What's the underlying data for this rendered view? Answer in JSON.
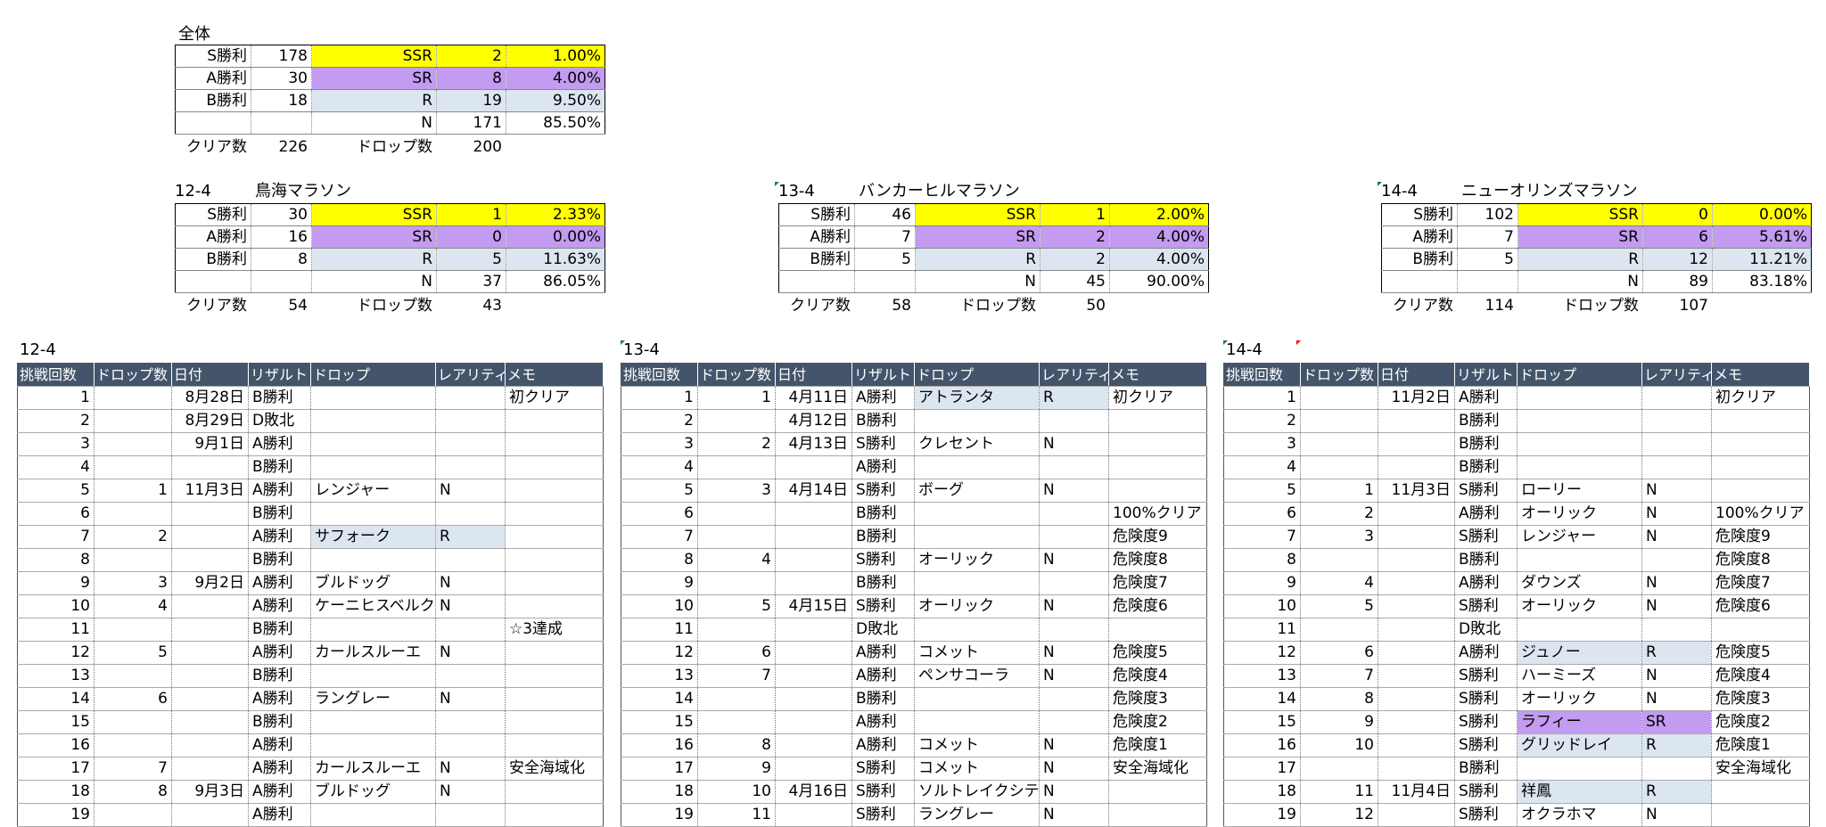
{
  "overall": {
    "label": "全体",
    "rows": [
      {
        "win": "S勝利",
        "wc": "178",
        "rar": "SSR",
        "cnt": "2",
        "pct": "1.00%"
      },
      {
        "win": "A勝利",
        "wc": "30",
        "rar": "SR",
        "cnt": "8",
        "pct": "4.00%"
      },
      {
        "win": "B勝利",
        "wc": "18",
        "rar": "R",
        "cnt": "19",
        "pct": "9.50%"
      },
      {
        "win": "",
        "wc": "",
        "rar": "N",
        "cnt": "171",
        "pct": "85.50%"
      }
    ],
    "clear_label": "クリア数",
    "clear": "226",
    "drop_label": "ドロップ数",
    "drop": "200"
  },
  "summaries": [
    {
      "id": "12-4",
      "name": "鳥海マラソン",
      "rows": [
        {
          "win": "S勝利",
          "wc": "30",
          "rar": "SSR",
          "cnt": "1",
          "pct": "2.33%"
        },
        {
          "win": "A勝利",
          "wc": "16",
          "rar": "SR",
          "cnt": "0",
          "pct": "0.00%"
        },
        {
          "win": "B勝利",
          "wc": "8",
          "rar": "R",
          "cnt": "5",
          "pct": "11.63%"
        },
        {
          "win": "",
          "wc": "",
          "rar": "N",
          "cnt": "37",
          "pct": "86.05%"
        }
      ],
      "clear_label": "クリア数",
      "clear": "54",
      "drop_label": "ドロップ数",
      "drop": "43"
    },
    {
      "id": "13-4",
      "name": "バンカーヒルマラソン",
      "rows": [
        {
          "win": "S勝利",
          "wc": "46",
          "rar": "SSR",
          "cnt": "1",
          "pct": "2.00%"
        },
        {
          "win": "A勝利",
          "wc": "7",
          "rar": "SR",
          "cnt": "2",
          "pct": "4.00%"
        },
        {
          "win": "B勝利",
          "wc": "5",
          "rar": "R",
          "cnt": "2",
          "pct": "4.00%"
        },
        {
          "win": "",
          "wc": "",
          "rar": "N",
          "cnt": "45",
          "pct": "90.00%"
        }
      ],
      "clear_label": "クリア数",
      "clear": "58",
      "drop_label": "ドロップ数",
      "drop": "50"
    },
    {
      "id": "14-4",
      "name": "ニューオリンズマラソン",
      "rows": [
        {
          "win": "S勝利",
          "wc": "102",
          "rar": "SSR",
          "cnt": "0",
          "pct": "0.00%"
        },
        {
          "win": "A勝利",
          "wc": "7",
          "rar": "SR",
          "cnt": "6",
          "pct": "5.61%"
        },
        {
          "win": "B勝利",
          "wc": "5",
          "rar": "R",
          "cnt": "12",
          "pct": "11.21%"
        },
        {
          "win": "",
          "wc": "",
          "rar": "N",
          "cnt": "89",
          "pct": "83.18%"
        }
      ],
      "clear_label": "クリア数",
      "clear": "114",
      "drop_label": "ドロップ数",
      "drop": "107"
    }
  ],
  "headers": [
    "挑戦回数",
    "ドロップ数",
    "日付",
    "リザルト",
    "ドロップ",
    "レアリティ",
    "メモ"
  ],
  "logs": [
    {
      "id": "12-4",
      "rows": [
        [
          "1",
          "",
          "8月28日",
          "B勝利",
          "",
          "",
          "初クリア"
        ],
        [
          "2",
          "",
          "8月29日",
          "D敗北",
          "",
          "",
          ""
        ],
        [
          "3",
          "",
          "9月1日",
          "A勝利",
          "",
          "",
          ""
        ],
        [
          "4",
          "",
          "",
          "B勝利",
          "",
          "",
          ""
        ],
        [
          "5",
          "1",
          "11月3日",
          "A勝利",
          "レンジャー",
          "N",
          ""
        ],
        [
          "6",
          "",
          "",
          "B勝利",
          "",
          "",
          ""
        ],
        [
          "7",
          "2",
          "",
          "A勝利",
          "サフォーク",
          "R",
          ""
        ],
        [
          "8",
          "",
          "",
          "B勝利",
          "",
          "",
          ""
        ],
        [
          "9",
          "3",
          "9月2日",
          "A勝利",
          "ブルドッグ",
          "N",
          ""
        ],
        [
          "10",
          "4",
          "",
          "A勝利",
          "ケーニヒスベルク",
          "N",
          ""
        ],
        [
          "11",
          "",
          "",
          "B勝利",
          "",
          "",
          "☆3達成"
        ],
        [
          "12",
          "5",
          "",
          "A勝利",
          "カールスルーエ",
          "N",
          ""
        ],
        [
          "13",
          "",
          "",
          "B勝利",
          "",
          "",
          ""
        ],
        [
          "14",
          "6",
          "",
          "A勝利",
          "ラングレー",
          "N",
          ""
        ],
        [
          "15",
          "",
          "",
          "B勝利",
          "",
          "",
          ""
        ],
        [
          "16",
          "",
          "",
          "A勝利",
          "",
          "",
          ""
        ],
        [
          "17",
          "7",
          "",
          "A勝利",
          "カールスルーエ",
          "N",
          "安全海域化"
        ],
        [
          "18",
          "8",
          "9月3日",
          "A勝利",
          "ブルドッグ",
          "N",
          ""
        ],
        [
          "19",
          "",
          "",
          "A勝利",
          "",
          "",
          ""
        ]
      ]
    },
    {
      "id": "13-4",
      "rows": [
        [
          "1",
          "1",
          "4月11日",
          "A勝利",
          "アトランタ",
          "R",
          "初クリア"
        ],
        [
          "2",
          "",
          "4月12日",
          "B勝利",
          "",
          "",
          ""
        ],
        [
          "3",
          "2",
          "4月13日",
          "S勝利",
          "クレセント",
          "N",
          ""
        ],
        [
          "4",
          "",
          "",
          "A勝利",
          "",
          "",
          ""
        ],
        [
          "5",
          "3",
          "4月14日",
          "S勝利",
          "ボーグ",
          "N",
          ""
        ],
        [
          "6",
          "",
          "",
          "B勝利",
          "",
          "",
          "100%クリア"
        ],
        [
          "7",
          "",
          "",
          "B勝利",
          "",
          "",
          "危険度9"
        ],
        [
          "8",
          "4",
          "",
          "S勝利",
          "オーリック",
          "N",
          "危険度8"
        ],
        [
          "9",
          "",
          "",
          "B勝利",
          "",
          "",
          "危険度7"
        ],
        [
          "10",
          "5",
          "4月15日",
          "S勝利",
          "オーリック",
          "N",
          "危険度6"
        ],
        [
          "11",
          "",
          "",
          "D敗北",
          "",
          "",
          ""
        ],
        [
          "12",
          "6",
          "",
          "A勝利",
          "コメット",
          "N",
          "危険度5"
        ],
        [
          "13",
          "7",
          "",
          "A勝利",
          "ペンサコーラ",
          "N",
          "危険度4"
        ],
        [
          "14",
          "",
          "",
          "B勝利",
          "",
          "",
          "危険度3"
        ],
        [
          "15",
          "",
          "",
          "A勝利",
          "",
          "",
          "危険度2"
        ],
        [
          "16",
          "8",
          "",
          "A勝利",
          "コメット",
          "N",
          "危険度1"
        ],
        [
          "17",
          "9",
          "",
          "S勝利",
          "コメット",
          "N",
          "安全海域化"
        ],
        [
          "18",
          "10",
          "4月16日",
          "S勝利",
          "ソルトレイクシティ",
          "N",
          ""
        ],
        [
          "19",
          "11",
          "",
          "S勝利",
          "ラングレー",
          "N",
          ""
        ]
      ]
    },
    {
      "id": "14-4",
      "rows": [
        [
          "1",
          "",
          "11月2日",
          "A勝利",
          "",
          "",
          "初クリア"
        ],
        [
          "2",
          "",
          "",
          "B勝利",
          "",
          "",
          ""
        ],
        [
          "3",
          "",
          "",
          "B勝利",
          "",
          "",
          ""
        ],
        [
          "4",
          "",
          "",
          "B勝利",
          "",
          "",
          ""
        ],
        [
          "5",
          "1",
          "11月3日",
          "S勝利",
          "ローリー",
          "N",
          ""
        ],
        [
          "6",
          "2",
          "",
          "A勝利",
          "オーリック",
          "N",
          "100%クリア"
        ],
        [
          "7",
          "3",
          "",
          "S勝利",
          "レンジャー",
          "N",
          "危険度9"
        ],
        [
          "8",
          "",
          "",
          "B勝利",
          "",
          "",
          "危険度8"
        ],
        [
          "9",
          "4",
          "",
          "A勝利",
          "ダウンズ",
          "N",
          "危険度7"
        ],
        [
          "10",
          "5",
          "",
          "S勝利",
          "オーリック",
          "N",
          "危険度6"
        ],
        [
          "11",
          "",
          "",
          "D敗北",
          "",
          "",
          ""
        ],
        [
          "12",
          "6",
          "",
          "A勝利",
          "ジュノー",
          "R",
          "危険度5"
        ],
        [
          "13",
          "7",
          "",
          "S勝利",
          "ハーミーズ",
          "N",
          "危険度4"
        ],
        [
          "14",
          "8",
          "",
          "S勝利",
          "オーリック",
          "N",
          "危険度3"
        ],
        [
          "15",
          "9",
          "",
          "S勝利",
          "ラフィー",
          "SR",
          "危険度2"
        ],
        [
          "16",
          "10",
          "",
          "S勝利",
          "グリッドレイ",
          "R",
          "危険度1"
        ],
        [
          "17",
          "",
          "",
          "B勝利",
          "",
          "",
          "安全海域化"
        ],
        [
          "18",
          "11",
          "11月4日",
          "S勝利",
          "祥鳳",
          "R",
          ""
        ],
        [
          "19",
          "12",
          "",
          "S勝利",
          "オクラホマ",
          "N",
          ""
        ]
      ]
    }
  ]
}
